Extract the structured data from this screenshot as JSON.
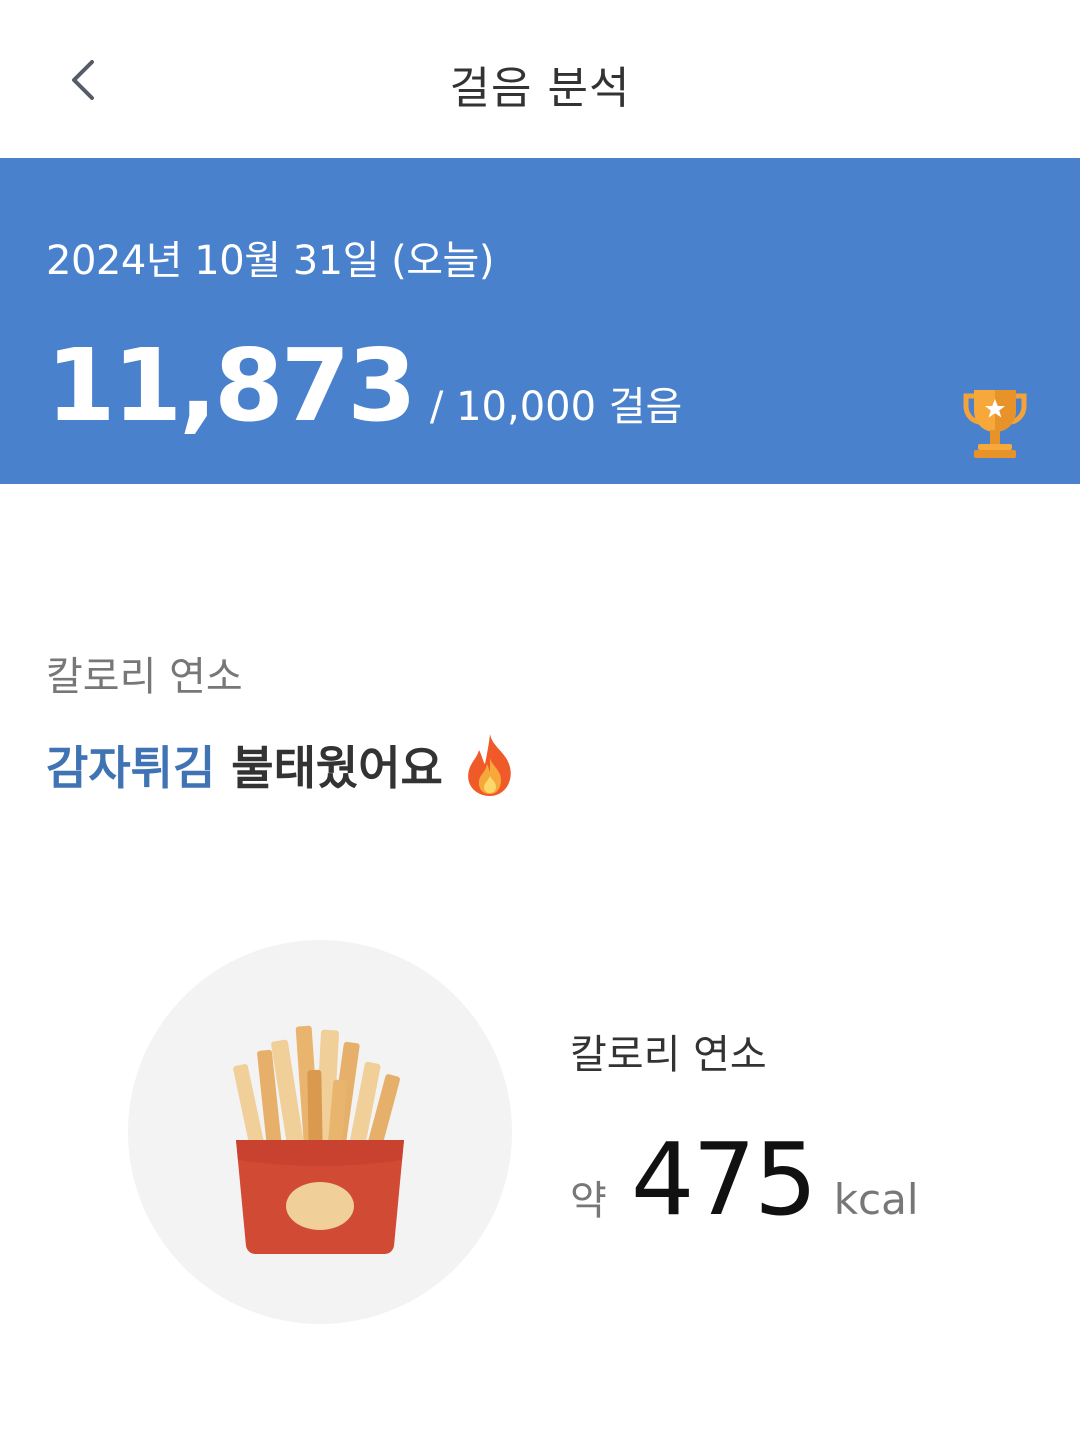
{
  "header": {
    "title": "걸음 분석",
    "back_icon": "chevron-left-icon"
  },
  "summary": {
    "date": "2024년 10월 31일 (오늘)",
    "steps": "11,873",
    "goal": "/ 10,000 걸음",
    "trophy_icon": "trophy-icon",
    "background_color": "#4a81cc"
  },
  "calories": {
    "section_label": "칼로리 연소",
    "headline_food": "감자튀김",
    "headline_rest": "불태웠어요",
    "headline_emoji": "fire-icon",
    "food_icon": "french-fries-icon",
    "label": "칼로리 연소",
    "approx": "약",
    "value": "475",
    "unit": "kcal",
    "accent_color": "#3f73b4"
  }
}
